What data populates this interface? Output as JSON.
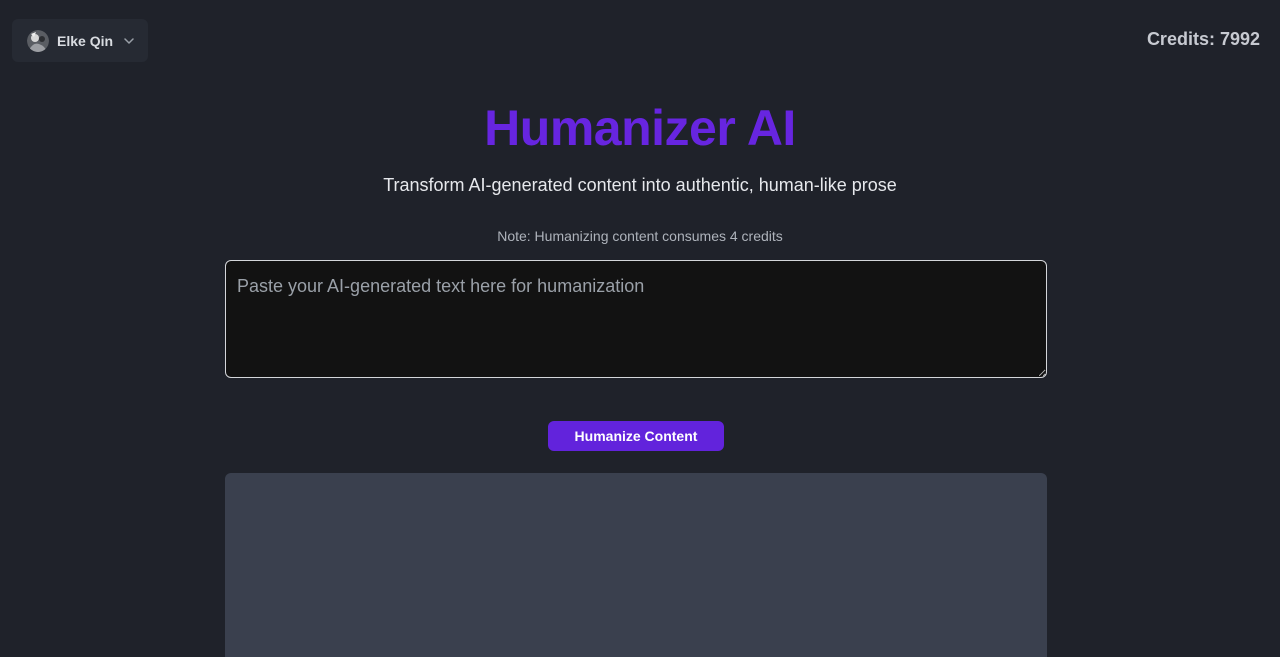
{
  "header": {
    "user": {
      "name": "Elke Qin",
      "avatar_icon": "user-avatar-photo",
      "menu_icon": "chevron-down-icon"
    },
    "credits_label": "Credits: 7992"
  },
  "hero": {
    "title": "Humanizer AI",
    "subtitle": "Transform AI-generated content into authentic, human-like prose",
    "note": "Note: Humanizing content consumes 4 credits"
  },
  "editor": {
    "value": "",
    "placeholder": "Paste your AI-generated text here for humanization"
  },
  "actions": {
    "humanize_label": "Humanize Content"
  },
  "output": {
    "text": ""
  },
  "colors": {
    "background": "#1f222a",
    "accent": "#6223dc",
    "title": "#6725e0",
    "output_panel": "#3a404e",
    "input_bg": "#121212"
  }
}
